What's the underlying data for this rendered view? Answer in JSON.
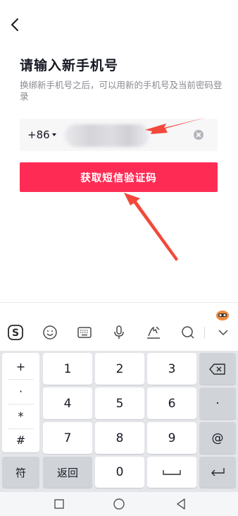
{
  "header": {
    "back_icon": "chevron-left-icon"
  },
  "page": {
    "title": "请输入新手机号",
    "subtitle": "换绑新手机号之后，可以用新的手机号及当前密码登录"
  },
  "phone": {
    "country_code": "+86",
    "value": "",
    "clear_icon": "clear-circle-icon"
  },
  "actions": {
    "get_code_label": "获取短信验证码"
  },
  "colors": {
    "accent": "#fe2c55",
    "arrow": "#f2493a"
  },
  "keyboard": {
    "toolbar_icons": [
      "sogou-logo-icon",
      "emoji-icon",
      "keyboard-icon",
      "microphone-icon",
      "handwriting-icon",
      "search-icon",
      "collapse-icon"
    ],
    "symbols": [
      "+",
      "·",
      "*",
      "#"
    ],
    "digits": [
      "1",
      "2",
      "3",
      "4",
      "5",
      "6",
      "7",
      "8",
      "9",
      "0"
    ],
    "side_keys": {
      "dot": "·",
      "at": "@"
    },
    "bottom": {
      "symbol": "符",
      "back": "返回"
    }
  },
  "navbar": {
    "icons": [
      "recents-square-icon",
      "home-circle-icon",
      "back-triangle-icon"
    ]
  }
}
